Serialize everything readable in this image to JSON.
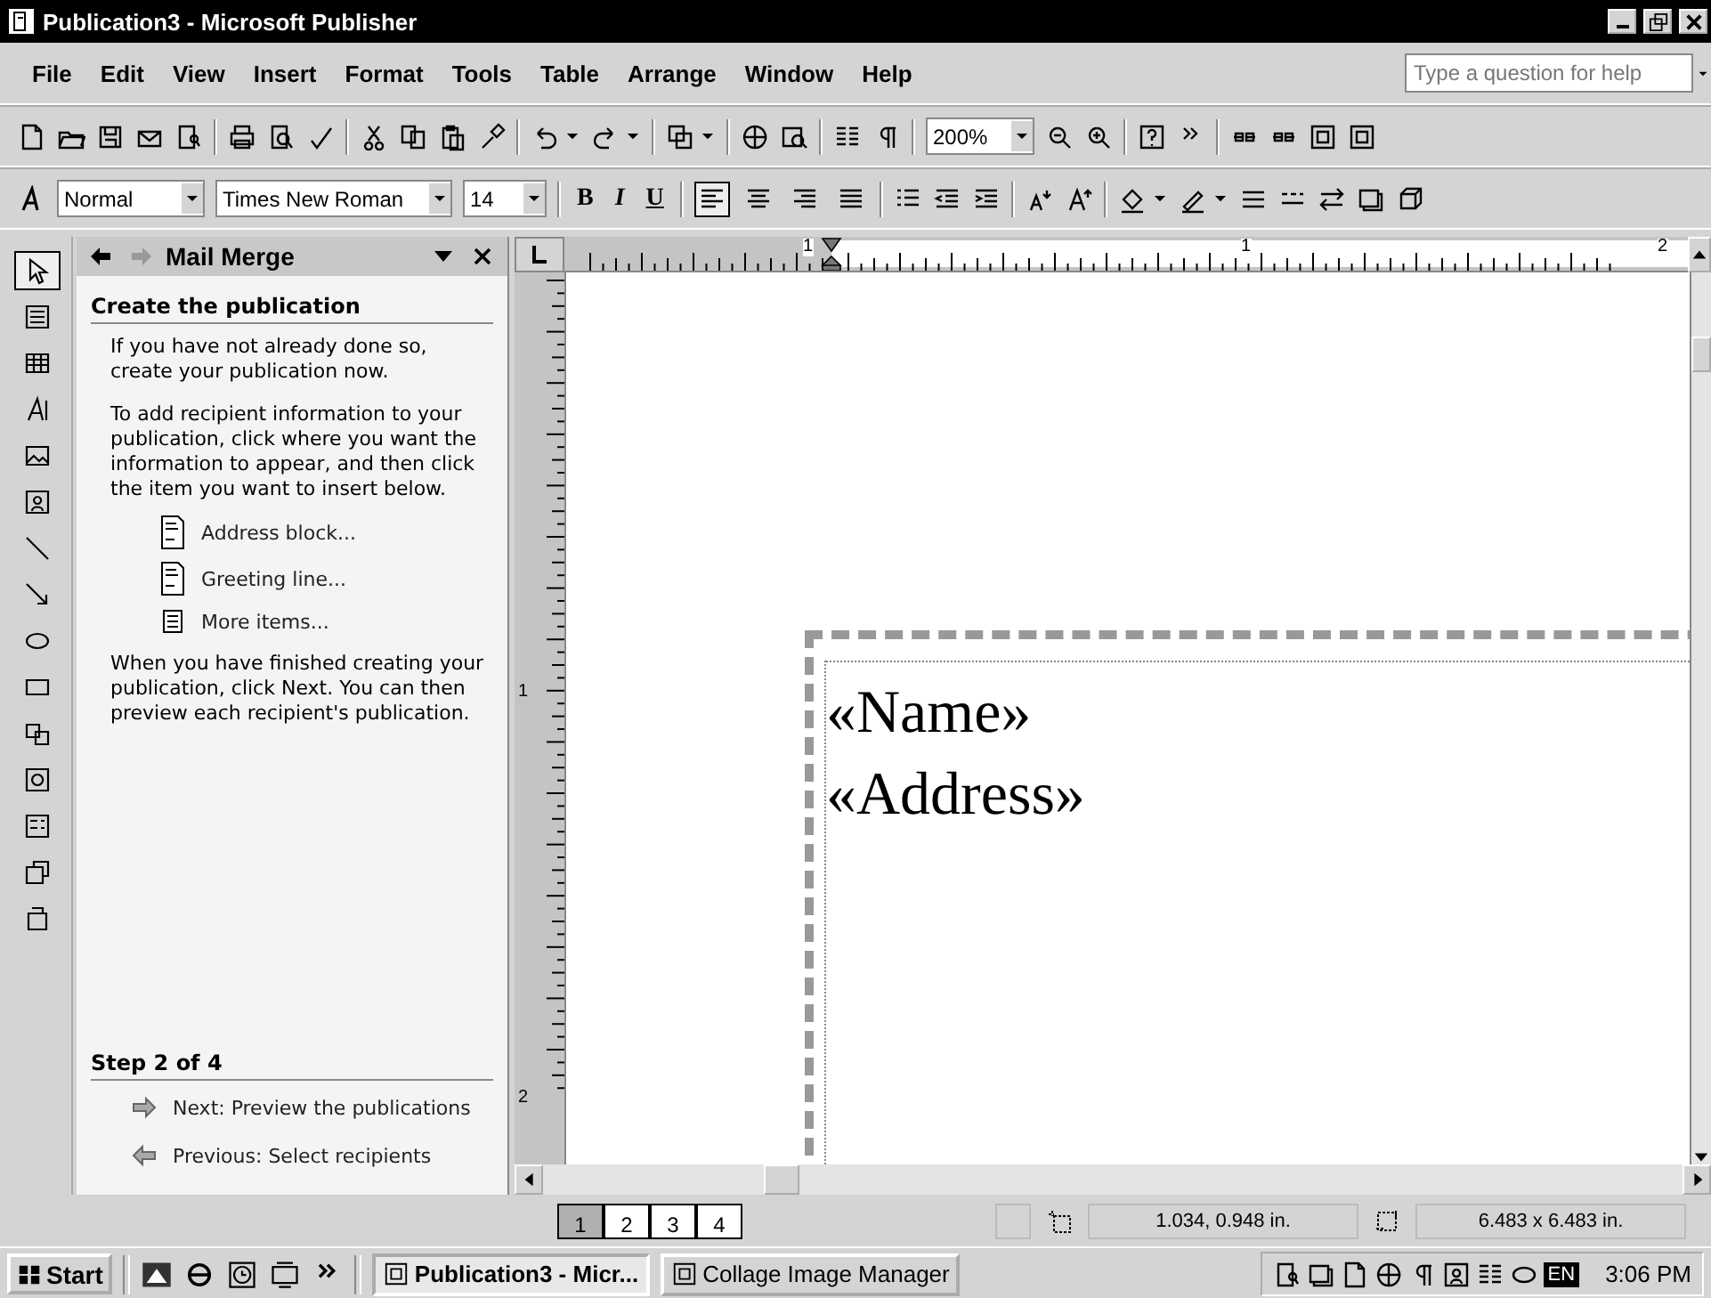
{
  "window": {
    "title": "Publication3 - Microsoft Publisher"
  },
  "menu": [
    "File",
    "Edit",
    "View",
    "Insert",
    "Format",
    "Tools",
    "Table",
    "Arrange",
    "Window",
    "Help"
  ],
  "help_box": {
    "placeholder": "Type a question for help"
  },
  "standard_toolbar": {
    "zoom": "200%"
  },
  "formatting_toolbar": {
    "style": "Normal",
    "font": "Times New Roman",
    "size": "14",
    "text_buttons": [
      {
        "label": "B",
        "kind": "bold"
      },
      {
        "label": "I",
        "kind": "italic"
      },
      {
        "label": "U",
        "kind": "underline"
      }
    ],
    "alignment": [
      {
        "selected": true
      },
      {
        "selected": false
      },
      {
        "selected": false
      },
      {
        "selected": false
      }
    ]
  },
  "object_tools": [
    {
      "selected": true
    },
    {
      "selected": false
    },
    {
      "selected": false
    },
    {
      "selected": false
    },
    {
      "selected": false
    },
    {
      "selected": false
    },
    {
      "selected": false
    },
    {
      "selected": false
    },
    {
      "selected": false
    },
    {
      "selected": false
    },
    {
      "selected": false
    },
    {
      "selected": false
    },
    {
      "selected": false
    },
    {
      "selected": false
    },
    {
      "selected": false
    }
  ],
  "task_pane": {
    "title": "Mail Merge",
    "heading": "Create the publication",
    "intro": [
      "If you have not already done so, create your publication now.",
      "To add recipient information to your publication, click where you want the information to appear, and then click the item you want to insert below."
    ],
    "items": [
      {
        "kind": "document",
        "label": "Address block..."
      },
      {
        "kind": "document",
        "label": "Greeting line..."
      },
      {
        "kind": "list",
        "label": "More items..."
      }
    ],
    "outro": "When you have finished creating your publication, click Next. You can then preview each recipient's publication.",
    "step": "Step 2 of 4",
    "next": "Next: Preview the publications",
    "previous": "Previous: Select recipients"
  },
  "rulers": {
    "horizontal": [
      "1",
      "1",
      "2"
    ],
    "vertical": [
      "1",
      "2"
    ]
  },
  "page": {
    "fields": [
      "«Name»",
      "«Address»"
    ]
  },
  "status_bar": {
    "pages": [
      {
        "label": "1",
        "selected": true
      },
      {
        "label": "2",
        "selected": false
      },
      {
        "label": "3",
        "selected": false
      },
      {
        "label": "4",
        "selected": false
      }
    ],
    "position": "1.034, 0.948 in.",
    "size": "6.483 x 6.483 in."
  },
  "taskbar": {
    "start": "Start",
    "tasks": [
      {
        "label": "Publication3 - Micr...",
        "selected": true
      },
      {
        "label": "Collage Image Manager",
        "selected": false
      }
    ],
    "language": "EN",
    "clock": "3:06 PM"
  }
}
